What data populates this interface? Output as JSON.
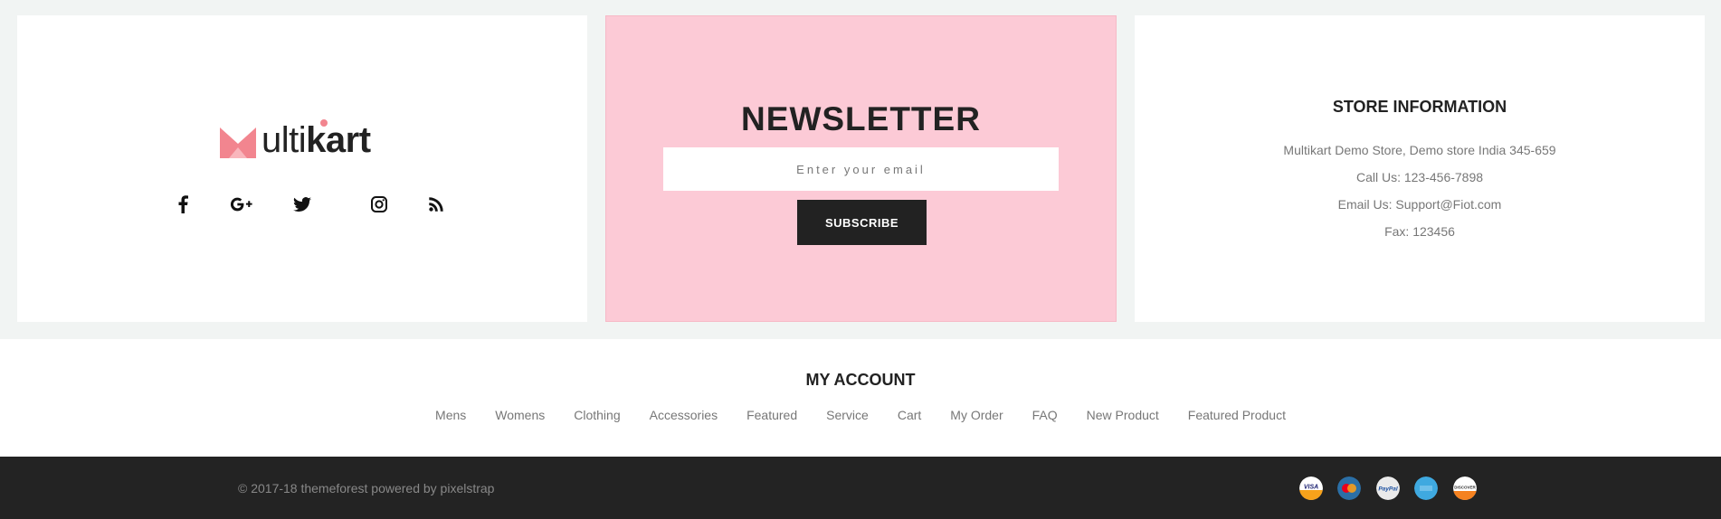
{
  "logo": {
    "text_thin": "ulti",
    "text_bold": "kart",
    "icon": "crown-m-logo-icon",
    "brand_color": "#f2858f"
  },
  "social": [
    {
      "name": "facebook-icon"
    },
    {
      "name": "google-plus-icon"
    },
    {
      "name": "twitter-icon"
    },
    {
      "name": "instagram-icon"
    },
    {
      "name": "rss-icon"
    }
  ],
  "newsletter": {
    "title": "NEWSLETTER",
    "placeholder": "Enter your email",
    "button": "SUBSCRIBE",
    "bg_color": "#fccad6"
  },
  "store": {
    "title": "STORE INFORMATION",
    "lines": [
      "Multikart Demo Store, Demo store India 345-659",
      "Call Us: 123-456-7898",
      "Email Us: Support@Fiot.com",
      "Fax: 123456"
    ]
  },
  "account": {
    "title": "MY ACCOUNT",
    "links": [
      "Mens",
      "Womens",
      "Clothing",
      "Accessories",
      "Featured",
      "Service",
      "Cart",
      "My Order",
      "FAQ",
      "New Product",
      "Featured Product"
    ]
  },
  "footer": {
    "copyright": "© 2017-18 themeforest powered by pixelstrap",
    "payments": [
      "visa-icon",
      "mastercard-icon",
      "paypal-icon",
      "american-express-icon",
      "discover-icon"
    ],
    "bg_color": "#232323"
  }
}
